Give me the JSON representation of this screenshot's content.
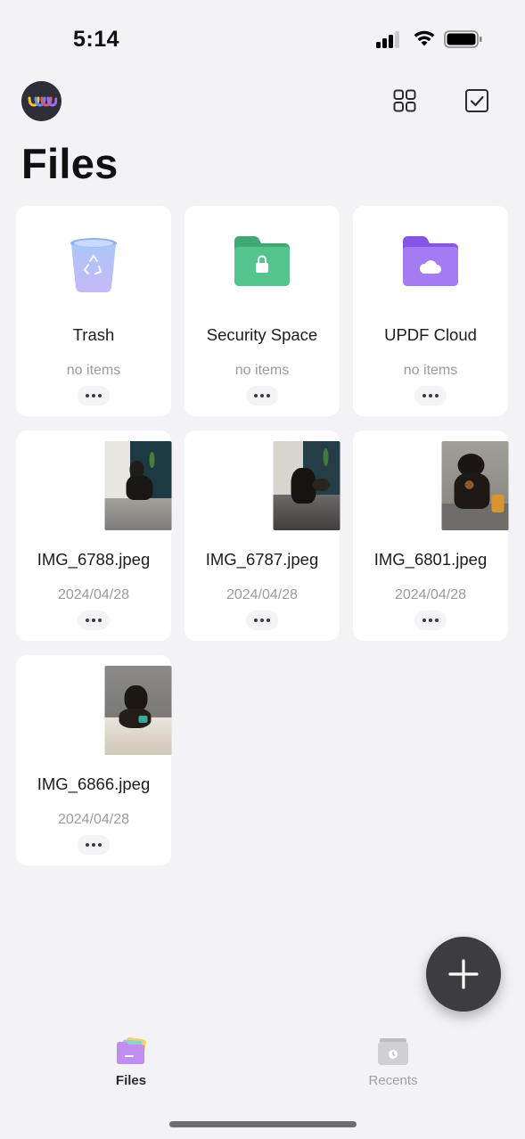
{
  "status_bar": {
    "time": "5:14"
  },
  "header": {
    "title": "Files"
  },
  "system_folders": [
    {
      "name": "Trash",
      "subtitle": "no items",
      "icon": "trash-bin-icon"
    },
    {
      "name": "Security Space",
      "subtitle": "no items",
      "icon": "locked-folder-icon"
    },
    {
      "name": "UPDF Cloud",
      "subtitle": "no items",
      "icon": "cloud-folder-icon"
    }
  ],
  "files": [
    {
      "name": "IMG_6788.jpeg",
      "date": "2024/04/28"
    },
    {
      "name": "IMG_6787.jpeg",
      "date": "2024/04/28"
    },
    {
      "name": "IMG_6801.jpeg",
      "date": "2024/04/28"
    },
    {
      "name": "IMG_6866.jpeg",
      "date": "2024/04/28"
    }
  ],
  "tab_bar": {
    "files_label": "Files",
    "recents_label": "Recents",
    "active": "Files"
  },
  "colors": {
    "background": "#f2f2f7",
    "security_folder": "#4cc08a",
    "cloud_folder": "#9b6ef0",
    "trash": "#b7c2f5",
    "fab": "#3d3d40"
  }
}
